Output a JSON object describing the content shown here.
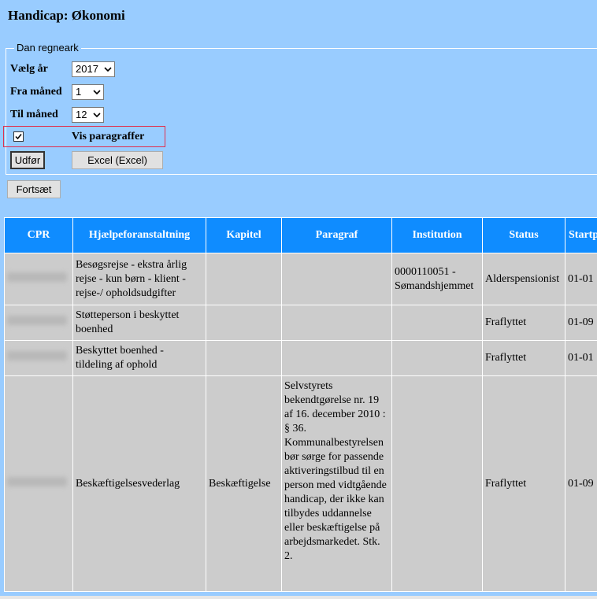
{
  "page": {
    "title": "Handicap: Økonomi"
  },
  "form": {
    "legend": "Dan regneark",
    "year": {
      "label": "Vælg år",
      "value": "2017"
    },
    "from_month": {
      "label": "Fra måned",
      "value": "1"
    },
    "to_month": {
      "label": "Til måned",
      "value": "12"
    },
    "vis_paragraffer": {
      "label": "Vis paragraffer",
      "checked": true
    },
    "buttons": {
      "udfor": "Udfør",
      "excel": "Excel (Excel)"
    }
  },
  "continue_button": "Fortsæt",
  "table": {
    "headers": [
      "CPR",
      "Hjælpeforanstaltning",
      "Kapitel",
      "Paragraf",
      "Institution",
      "Status",
      "Startp"
    ],
    "rows": [
      {
        "hjaelp": "Besøgsrejse - ekstra årlig rejse - kun børn - klient - rejse-/ opholdsudgifter",
        "kapitel": "",
        "paragraf": "",
        "institution": "0000110051 - Sømandshjemmet",
        "status": "Alderspensionist",
        "start": "01-01"
      },
      {
        "hjaelp": "Støtteperson i beskyttet boenhed",
        "kapitel": "",
        "paragraf": "",
        "institution": "",
        "status": "Fraflyttet",
        "start": "01-09"
      },
      {
        "hjaelp": "Beskyttet boenhed - tildeling af ophold",
        "kapitel": "",
        "paragraf": "",
        "institution": "",
        "status": "Fraflyttet",
        "start": "01-01"
      },
      {
        "hjaelp": "Beskæftigelsesvederlag",
        "kapitel": "Beskæftigelse",
        "paragraf": "Selvstyrets bekendtgørelse nr. 19 af 16. december 2010 : § 36. Kommunalbestyrelsen bør sørge for passende aktiveringstilbud til en person med vidtgående handicap, der ikke kan tilbydes uddannelse eller beskæftigelse på arbejdsmarkedet. Stk. 2.",
        "institution": "",
        "status": "Fraflyttet",
        "start": "01-09"
      }
    ]
  }
}
